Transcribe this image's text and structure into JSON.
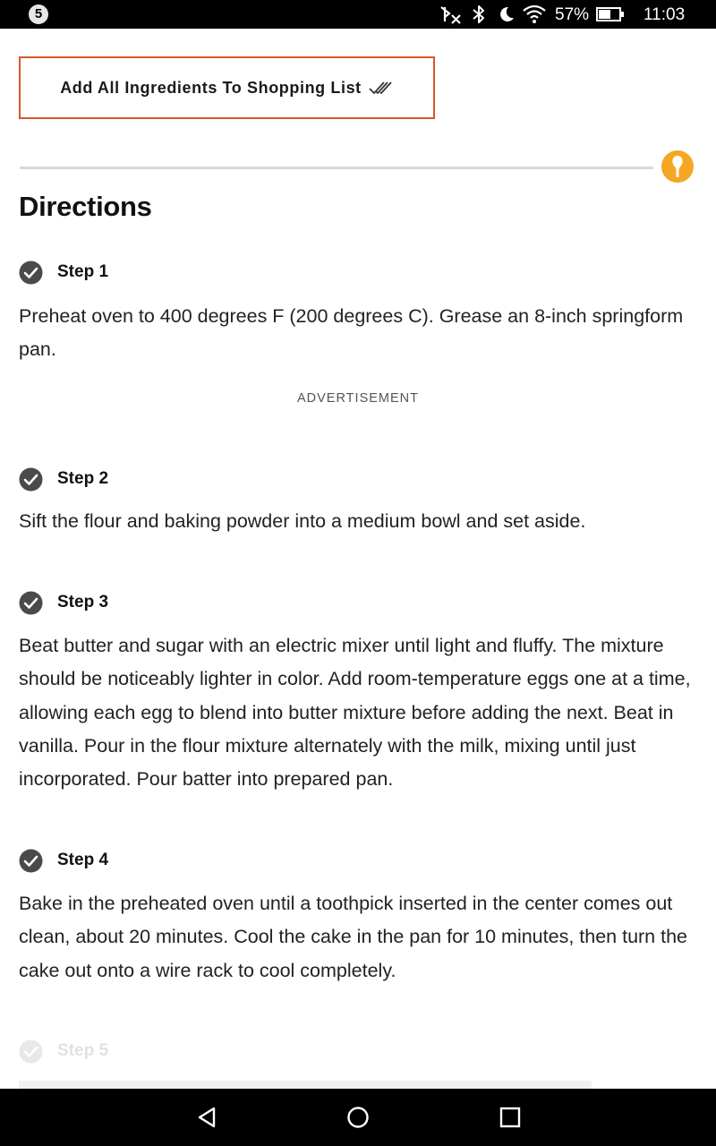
{
  "status_bar": {
    "notification_count": "5",
    "battery_percent": "57%",
    "time": "11:03",
    "icons": [
      "bluetooth-off-icon",
      "bluetooth-icon",
      "do-not-disturb-moon-icon",
      "wifi-icon",
      "battery-icon"
    ]
  },
  "shopping": {
    "button_label": "Add All Ingredients To Shopping List",
    "button_icon": "double-check-icon",
    "border_color": "#d4582b"
  },
  "section": {
    "heading": "Directions",
    "pin_icon_color": "#f5a623"
  },
  "advertisement_label": "ADVERTISEMENT",
  "steps": [
    {
      "label": "Step 1",
      "text": "Preheat oven to 400 degrees F (200 degrees C). Grease an 8-inch springform pan."
    },
    {
      "label": "Step 2",
      "text": "Sift the flour and baking powder into a medium bowl and set aside."
    },
    {
      "label": "Step 3",
      "text": "Beat butter and sugar with an electric mixer until light and fluffy. The mixture should be noticeably lighter in color. Add room-temperature eggs one at a time, allowing each egg to blend into butter mixture before adding the next. Beat in vanilla. Pour in the flour mixture alternately with the milk, mixing until just incorporated. Pour batter into prepared pan."
    },
    {
      "label": "Step 4",
      "text": "Bake in the preheated oven until a toothpick inserted in the center comes out clean, about 20 minutes. Cool the cake in the pan for 10 minutes, then turn the cake out onto a wire rack to cool completely."
    },
    {
      "label": "Step 5",
      "text": ""
    }
  ],
  "nav_bar": {
    "buttons": [
      "back-icon",
      "home-icon",
      "recents-icon"
    ]
  }
}
